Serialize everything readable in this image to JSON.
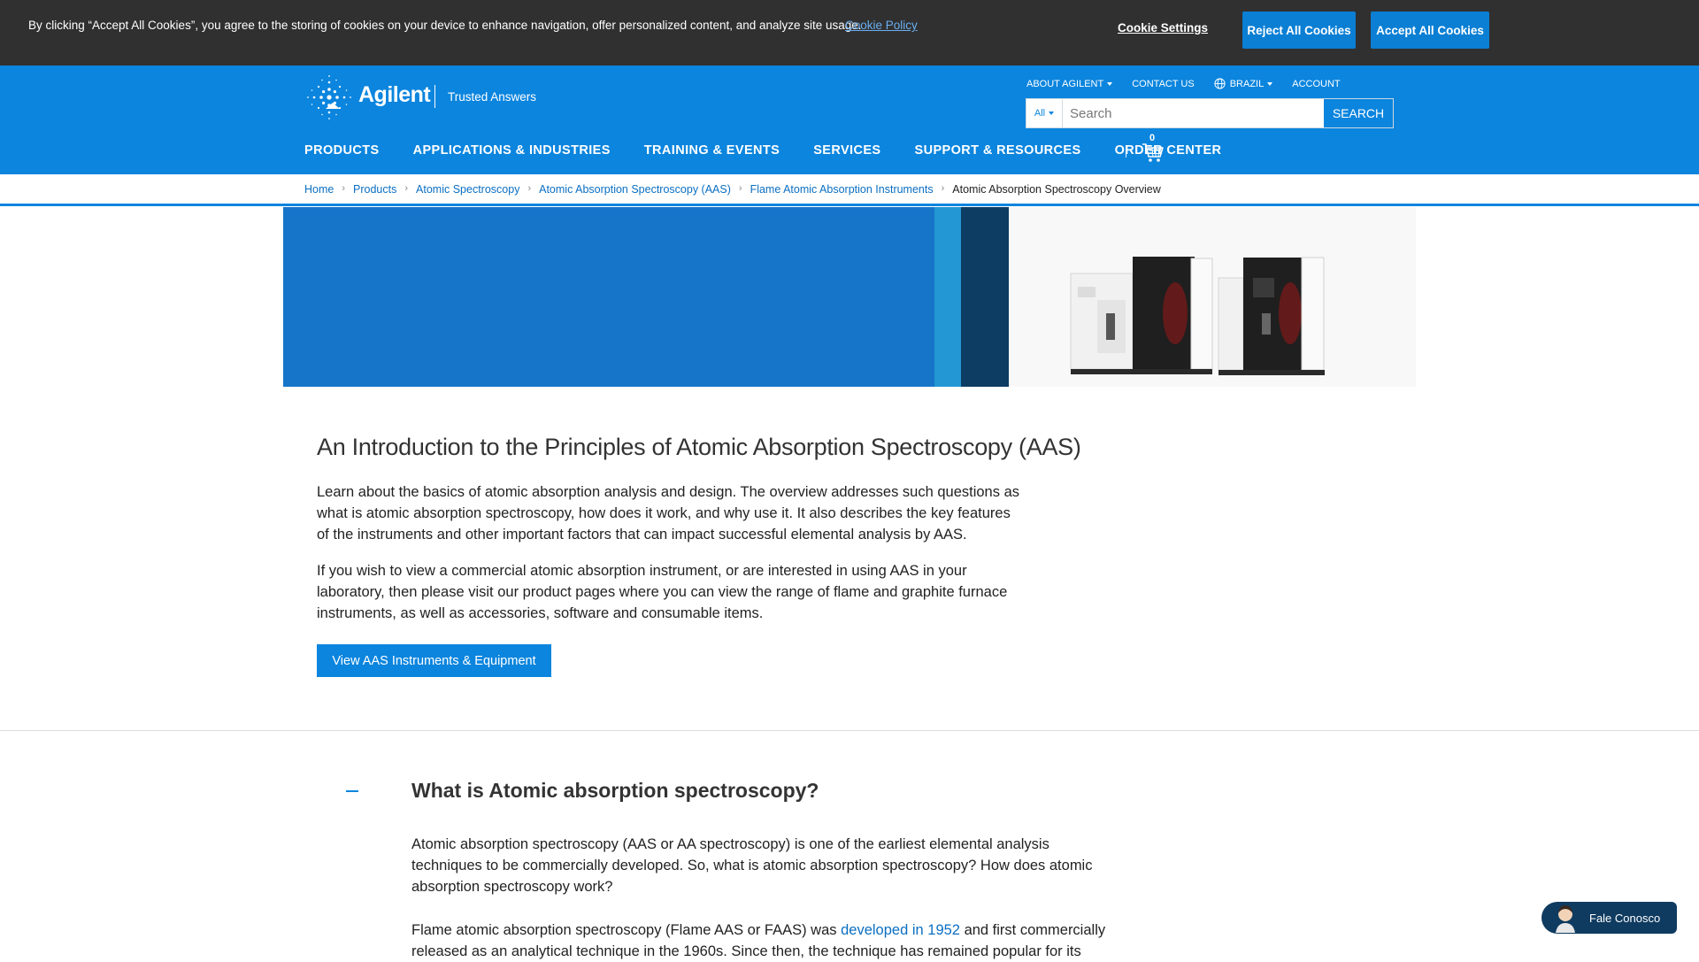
{
  "cookie_bar": {
    "message": "By clicking “Accept All Cookies”, you agree to the storing of cookies on your device to enhance navigation, offer personalized content, and analyze site usage.",
    "policy_link": "Cookie Policy",
    "settings_label": "Cookie Settings",
    "reject_label": "Reject All Cookies",
    "accept_label": "Accept All Cookies"
  },
  "header": {
    "brand": "Agilent",
    "tagline": "Trusted Answers",
    "utility_nav": [
      {
        "label": "ABOUT AGILENT",
        "dropdown": true
      },
      {
        "label": "CONTACT US",
        "dropdown": false
      },
      {
        "label": "BRAZIL",
        "dropdown": true,
        "icon": "globe-icon"
      },
      {
        "label": "ACCOUNT",
        "dropdown": false
      }
    ],
    "search": {
      "scope": "All",
      "placeholder": "Search",
      "button_label": "SEARCH"
    },
    "main_nav": [
      {
        "label": "PRODUCTS",
        "active": true
      },
      {
        "label": "APPLICATIONS & INDUSTRIES"
      },
      {
        "label": "TRAINING & EVENTS"
      },
      {
        "label": "SERVICES"
      },
      {
        "label": "SUPPORT & RESOURCES"
      },
      {
        "label": "ORDER CENTER"
      }
    ],
    "cart_count": "0"
  },
  "breadcrumb": {
    "items": [
      "Home",
      "Products",
      "Atomic Spectroscopy",
      "Atomic Absorption Spectroscopy (AAS)",
      "Flame Atomic Absorption Instruments"
    ],
    "current": "Atomic Absorption Spectroscopy Overview"
  },
  "intro": {
    "title": "An Introduction to the Principles of Atomic Absorption Spectroscopy (AAS)",
    "paragraph_1": "Learn about the basics of atomic absorption analysis and design. The overview addresses such questions as what is atomic absorption spectroscopy, how does it work, and why use it. It also describes the key features of the instruments and other important factors that can impact successful elemental analysis by AAS.",
    "paragraph_2": "If you wish to view a commercial atomic absorption instrument, or are interested in using AAS in your laboratory, then please visit our product pages where you can view the range of flame and graphite furnace instruments, as well as accessories, software and consumable items.",
    "cta_label": "View AAS Instruments & Equipment"
  },
  "accordion": {
    "title": "What is Atomic absorption spectroscopy?",
    "paragraph_1": "Atomic absorption spectroscopy (AAS or AA spectroscopy) is one of the earliest elemental analysis techniques to be commercially developed. So, what is atomic absorption spectroscopy? How does atomic absorption spectroscopy work?",
    "paragraph_2_before": "Flame atomic absorption spectroscopy (Flame AAS or FAAS) was ",
    "paragraph_2_link": "developed in 1952",
    "paragraph_2_after": " and first commercially released as an analytical technique in the 1960s. Since then, the technique has remained popular for its"
  },
  "chat": {
    "label": "Fale Conosco"
  },
  "colors": {
    "header_blue": "#0b85de",
    "cookie_bar_bg": "#303030",
    "hero_blue": "#1775c9",
    "hero_stripe_light": "#2297d3",
    "hero_stripe_dark": "#0e3d64",
    "chat_bg": "#0f3b60"
  }
}
